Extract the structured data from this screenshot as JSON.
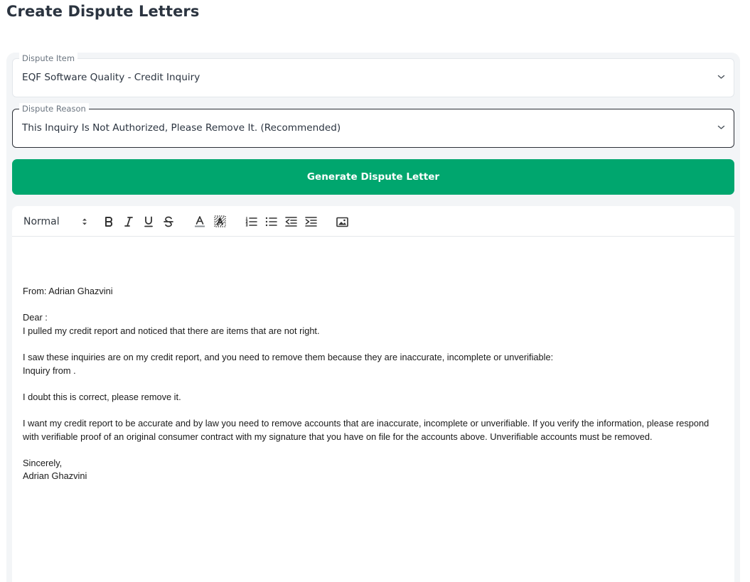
{
  "page": {
    "title": "Create Dispute Letters"
  },
  "form": {
    "dispute_item": {
      "label": "Dispute Item",
      "value": "EQF Software Quality - Credit Inquiry"
    },
    "dispute_reason": {
      "label": "Dispute Reason",
      "value": "This Inquiry Is Not Authorized, Please Remove It. (Recommended)"
    },
    "generate_label": "Generate Dispute Letter"
  },
  "editor": {
    "toolbar": {
      "format": "Normal",
      "icons": [
        "bold-icon",
        "italic-icon",
        "underline-icon",
        "strikethrough-icon",
        "font-color-icon",
        "background-color-icon",
        "ordered-list-icon",
        "bullet-list-icon",
        "outdent-icon",
        "indent-icon",
        "image-icon"
      ]
    },
    "letter": {
      "from": "From: Adrian Ghazvini",
      "greeting": "Dear :",
      "intro": "I pulled my credit report and noticed that there are items that are not right.",
      "inquiries_intro": "I saw these inquiries are on my credit report, and you need to remove them because they are inaccurate, incomplete or unverifiable:",
      "inquiry": "Inquiry from .",
      "doubt": "I doubt this is correct, please remove it.",
      "demand": "I want my credit report to be accurate and by law you need to remove accounts that are inaccurate, incomplete or unverifiable. If you verify the information, please respond with verifiable proof of an original consumer contract with my signature that you have on file for the accounts above. Unverifiable accounts must be removed.",
      "closing": "Sincerely,",
      "signature": "Adrian Ghazvini"
    }
  },
  "colors": {
    "accent": "#00a66e",
    "panel": "#f3f5f7",
    "text": "#2b3440"
  }
}
